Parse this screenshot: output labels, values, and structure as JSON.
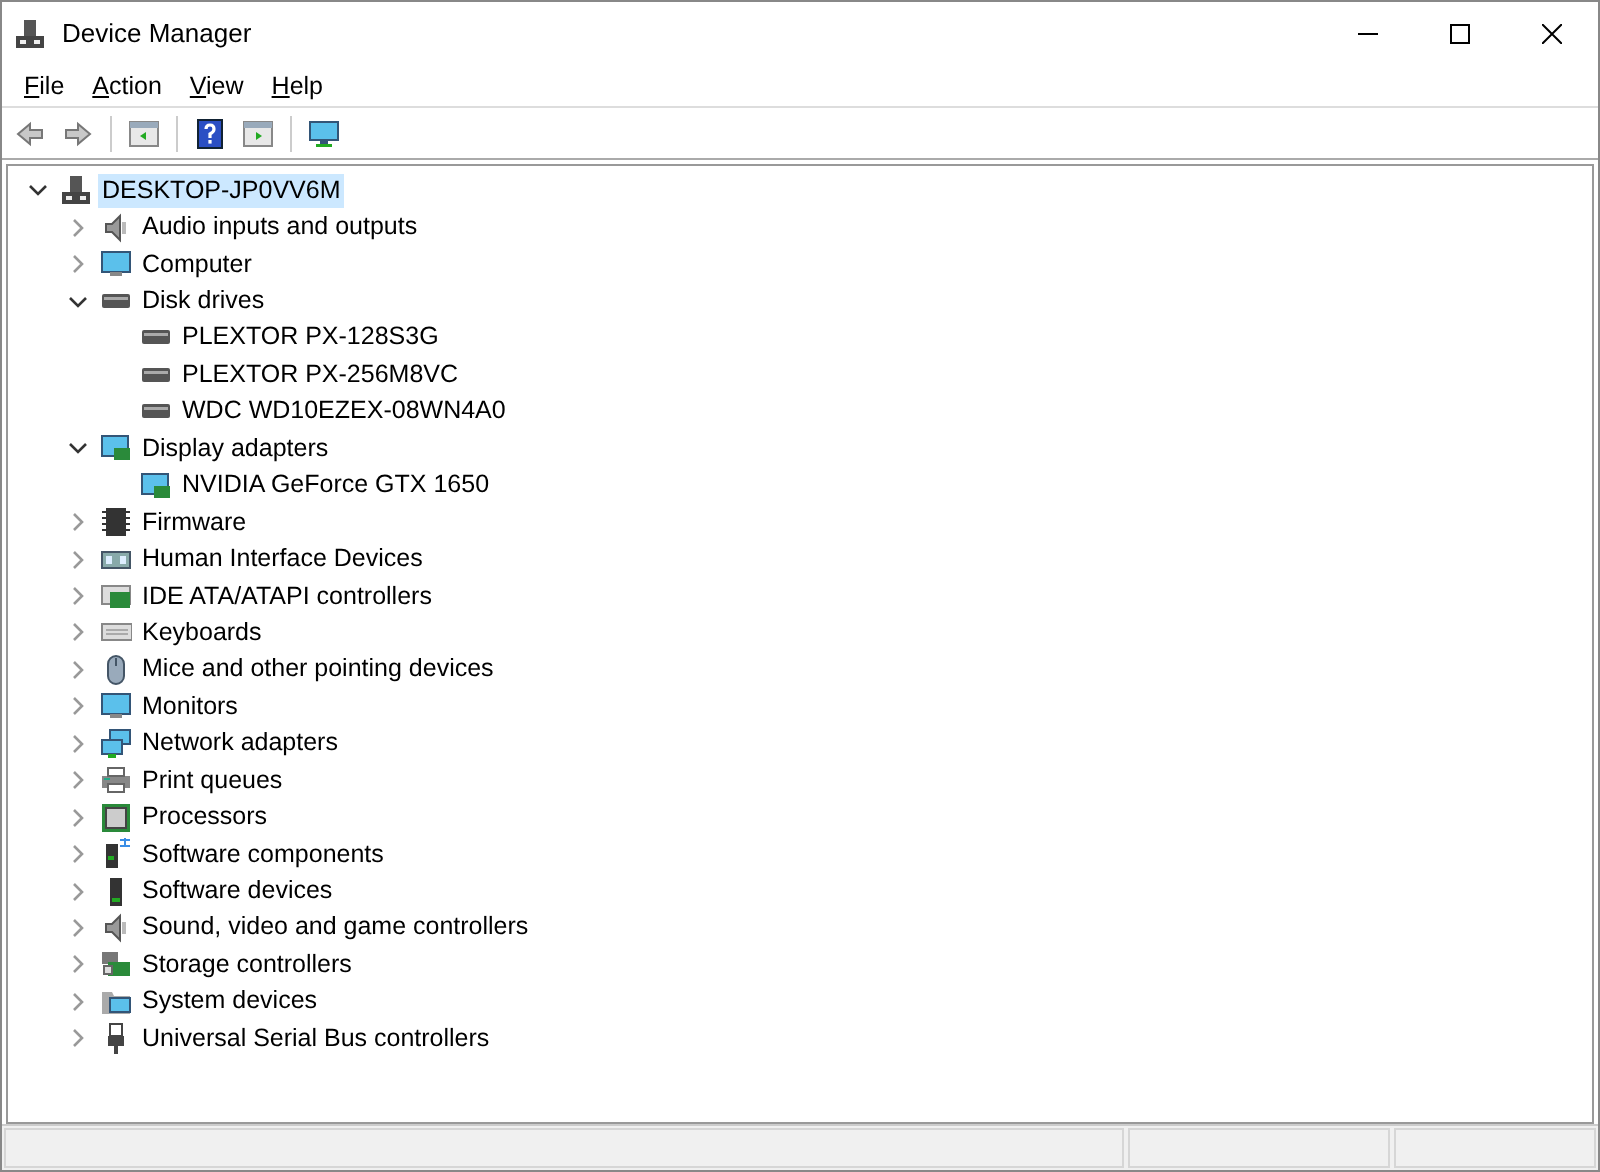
{
  "window": {
    "title": "Device Manager"
  },
  "menu": [
    {
      "label": "File"
    },
    {
      "label": "Action"
    },
    {
      "label": "View"
    },
    {
      "label": "Help"
    }
  ],
  "toolbar": [
    {
      "disabled": true
    },
    {
      "disabled": true
    },
    {
      "disabled": false
    },
    {
      "disabled": false
    },
    {
      "disabled": false
    },
    {
      "disabled": false
    }
  ],
  "tree": [
    {
      "label": "DESKTOP-JP0VV6M",
      "selected": true,
      "expanded": true,
      "children": [
        {
          "label": "Audio inputs and outputs",
          "selected": false,
          "expanded": false
        },
        {
          "label": "Computer",
          "selected": false,
          "expanded": false
        },
        {
          "label": "Disk drives",
          "selected": false,
          "expanded": true,
          "children": [
            {
              "label": "PLEXTOR PX-128S3G",
              "selected": false
            },
            {
              "label": "PLEXTOR PX-256M8VC",
              "selected": false
            },
            {
              "label": "WDC WD10EZEX-08WN4A0",
              "selected": false
            }
          ]
        },
        {
          "label": "Display adapters",
          "selected": false,
          "expanded": true,
          "children": [
            {
              "label": "NVIDIA GeForce GTX 1650",
              "selected": false
            }
          ]
        },
        {
          "label": "Firmware",
          "selected": false,
          "expanded": false
        },
        {
          "label": "Human Interface Devices",
          "selected": false,
          "expanded": false
        },
        {
          "label": "IDE ATA/ATAPI controllers",
          "selected": false,
          "expanded": false
        },
        {
          "label": "Keyboards",
          "selected": false,
          "expanded": false
        },
        {
          "label": "Mice and other pointing devices",
          "selected": false,
          "expanded": false
        },
        {
          "label": "Monitors",
          "selected": false,
          "expanded": false
        },
        {
          "label": "Network adapters",
          "selected": false,
          "expanded": false
        },
        {
          "label": "Print queues",
          "selected": false,
          "expanded": false
        },
        {
          "label": "Processors",
          "selected": false,
          "expanded": false
        },
        {
          "label": "Software components",
          "selected": false,
          "expanded": false
        },
        {
          "label": "Software devices",
          "selected": false,
          "expanded": false
        },
        {
          "label": "Sound, video and game controllers",
          "selected": false,
          "expanded": false
        },
        {
          "label": "Storage controllers",
          "selected": false,
          "expanded": false
        },
        {
          "label": "System devices",
          "selected": false,
          "expanded": false
        },
        {
          "label": "Universal Serial Bus controllers",
          "selected": false,
          "expanded": false
        }
      ]
    }
  ]
}
